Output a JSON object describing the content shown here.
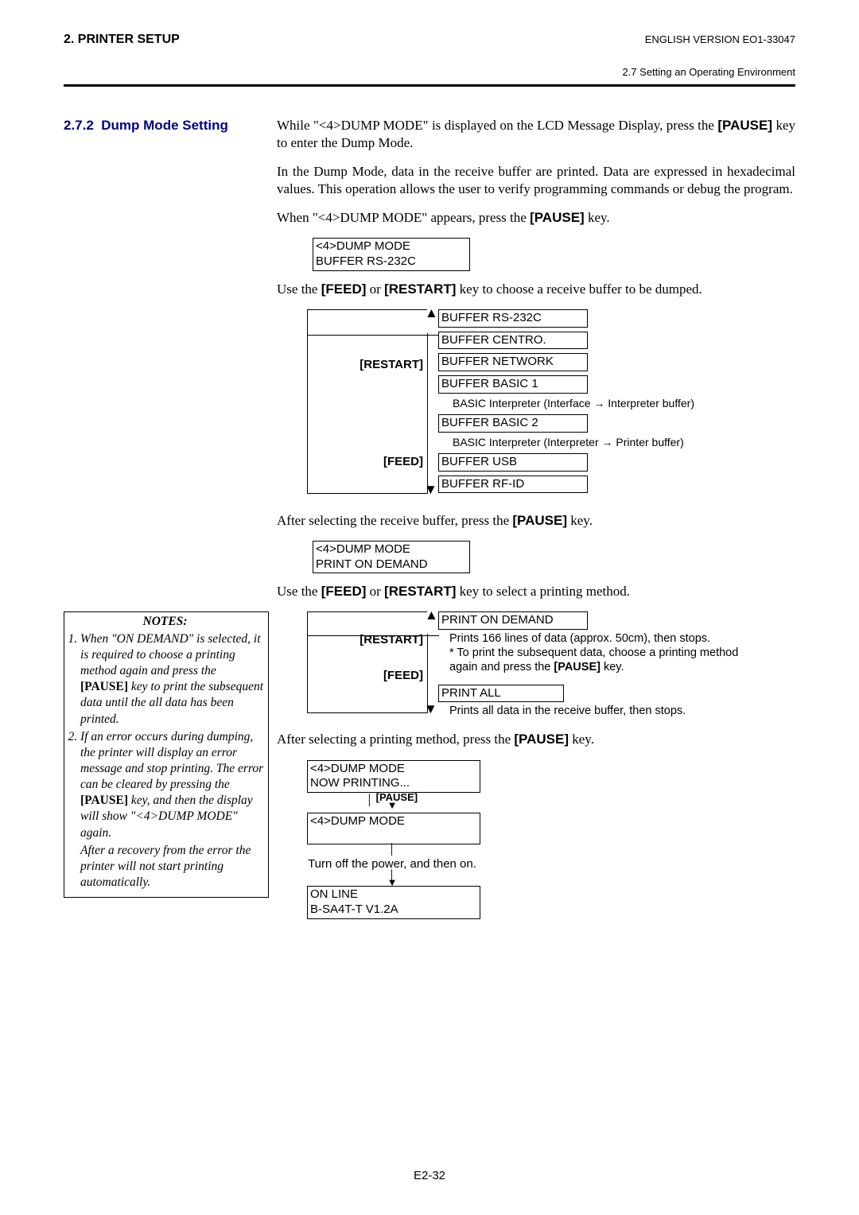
{
  "header": {
    "left": "2. PRINTER SETUP",
    "right": "ENGLISH VERSION EO1-33047",
    "sub": "2.7 Setting an Operating Environment"
  },
  "section": {
    "number": "2.7.2",
    "title": "Dump Mode Setting"
  },
  "body": {
    "p1a": "While \"<4>DUMP MODE\" is displayed on the LCD Message Display, press the ",
    "p1key": "[PAUSE]",
    "p1b": " key to enter the Dump Mode.",
    "p2": "In the Dump Mode, data in the receive buffer are printed.  Data are expressed in hexadecimal values.  This operation allows the user to verify programming commands or debug the program.",
    "p3a": "When \"<4>DUMP MODE\" appears, press the ",
    "p3key": "[PAUSE]",
    "p3b": " key.",
    "lcd1_l1": "<4>DUMP MODE",
    "lcd1_l2": "BUFFER   RS-232C",
    "p4a": "Use the ",
    "p4k1": "[FEED]",
    "p4mid": " or ",
    "p4k2": "[RESTART]",
    "p4b": " key to choose a receive buffer to be dumped.",
    "restart": "[RESTART]",
    "feed": "[FEED]",
    "opts": [
      "BUFFER   RS-232C",
      "BUFFER   CENTRO.",
      "BUFFER   NETWORK",
      "BUFFER   BASIC 1",
      "BUFFER   BASIC 2",
      "BUFFER   USB",
      "BUFFER   RF-ID"
    ],
    "anno1": "BASIC Interpreter (Interface → Interpreter buffer)",
    "anno2": "BASIC Interpreter (Interpreter → Printer buffer)",
    "p5a": "After selecting the receive buffer, press the ",
    "p5key": "[PAUSE]",
    "p5b": " key.",
    "lcd2_l1": "<4>DUMP MODE",
    "lcd2_l2": "PRINT   ON DEMAND",
    "p6a": "Use the ",
    "p6k1": "[FEED]",
    "p6mid": " or ",
    "p6k2": "[RESTART]",
    "p6b": " key to select a printing method.",
    "opt2_1": "PRINT   ON DEMAND",
    "opt2_1_desc_a": "Prints 166 lines of data (approx. 50cm), then stops.",
    "opt2_1_desc_b": "* To print the subsequent data, choose a printing method again and press the ",
    "opt2_1_desc_key": "[PAUSE]",
    "opt2_1_desc_c": " key.",
    "opt2_2": "PRINT   ALL",
    "opt2_2_desc": "Prints all data in the receive buffer, then stops.",
    "p7a": "After selecting a printing method, press the ",
    "p7key": "[PAUSE]",
    "p7b": " key.",
    "lcd3_l1": "<4>DUMP MODE",
    "lcd3_l2": "NOW PRINTING...",
    "pause_lbl": "[PAUSE]",
    "lcd4_l1": "<4>DUMP MODE",
    "lcd4_l2": " ",
    "turn_off": "Turn off the power, and then on.",
    "lcd5_l1": "ON LINE",
    "lcd5_l2": "B-SA4T-T   V1.2A"
  },
  "notes": {
    "title": "NOTES:",
    "li1a": "When \"ON DEMAND\" is selected, it is required to choose a printing method again and press the ",
    "li1key": "[PAUSE]",
    "li1b": " key to print the subsequent data until the all data has been printed.",
    "li2a": "  If an error occurs during dumping, the printer will display an error message and stop printing.  The error can be cleared by pressing the ",
    "li2key": "[PAUSE]",
    "li2b": " key, and then the display will show \"<4>DUMP MODE\" again.",
    "li2c": "After a recovery from the error the printer will not start printing automatically."
  },
  "footer": "E2-32"
}
